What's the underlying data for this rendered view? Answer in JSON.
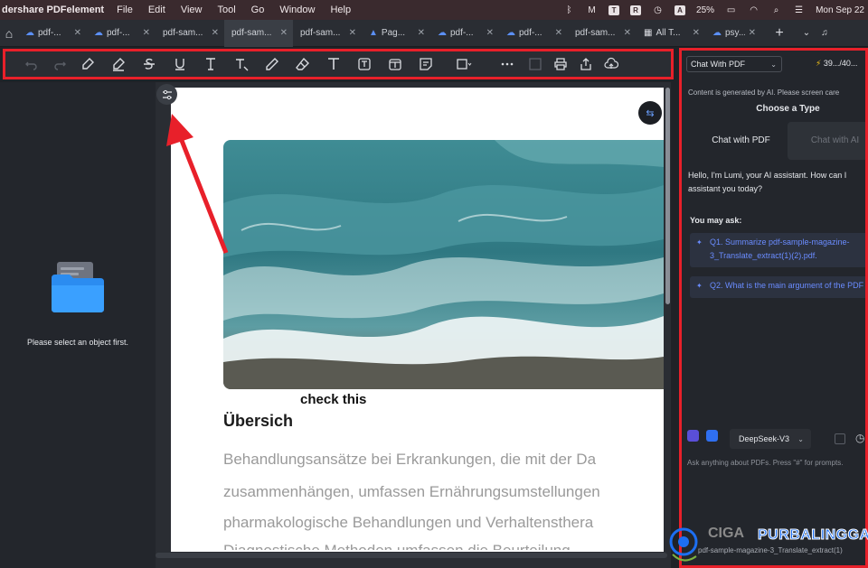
{
  "menubar": {
    "app_name": "dershare PDFelement",
    "items": [
      "File",
      "Edit",
      "View",
      "Tool",
      "Go",
      "Window",
      "Help"
    ],
    "battery": "25%",
    "datetime": "Mon Sep 22"
  },
  "tabs": [
    {
      "label": "pdf-...",
      "icon": "cloud-icon",
      "active": false
    },
    {
      "label": "pdf-...",
      "icon": "cloud-icon",
      "active": false
    },
    {
      "label": "pdf-sam...",
      "icon": "",
      "active": false
    },
    {
      "label": "pdf-sam...",
      "icon": "",
      "active": true
    },
    {
      "label": "pdf-sam...",
      "icon": "",
      "active": false
    },
    {
      "label": "Pag...",
      "icon": "pages-icon",
      "active": false
    },
    {
      "label": "pdf-...",
      "icon": "cloud-icon",
      "active": false
    },
    {
      "label": "pdf-...",
      "icon": "cloud-icon",
      "active": false
    },
    {
      "label": "pdf-sam...",
      "icon": "",
      "active": false
    },
    {
      "label": "All T...",
      "icon": "grid-icon",
      "active": false
    },
    {
      "label": "psy...",
      "icon": "cloud-icon",
      "active": false
    }
  ],
  "left_panel": {
    "message": "Please select an object first."
  },
  "document": {
    "caption": "check this",
    "heading": "Übersich",
    "body_lines": [
      "Behandlungsansätze bei Erkrankungen, die mit der Da",
      "zusammenhängen, umfassen Ernährungsumstellungen",
      "pharmakologische Behandlungen und Verhaltensthera",
      "Diagnostische Methoden umfassen die Beurteilung"
    ]
  },
  "ai_panel": {
    "mode_select": "Chat With PDF",
    "credits": "39.../40...",
    "notice": "Content is generated by AI. Please screen care",
    "choose_title": "Choose a Type",
    "type_pdf": "Chat with PDF",
    "type_ai": "Chat with AI",
    "greeting": "Hello, I'm Lumi, your AI assistant. How can I assistant you today?",
    "you_may_ask": "You may ask:",
    "q1": "Q1. Summarize pdf-sample-magazine-3_Translate_extract(1)(2).pdf.",
    "q2": "Q2. What is the main argument of the PDF",
    "model": "DeepSeek-V3",
    "input_placeholder": "Ask anything about PDFs. Press \"#\" for prompts.",
    "attached_file": "pdf-sample-magazine-3_Translate_extract(1)"
  },
  "watermark": {
    "prefix": "CIGA",
    "text": "PURBALINGGA"
  },
  "colors": {
    "highlight_red": "#e8202a",
    "link_blue": "#6a8cff",
    "panel_bg": "#23262c"
  }
}
